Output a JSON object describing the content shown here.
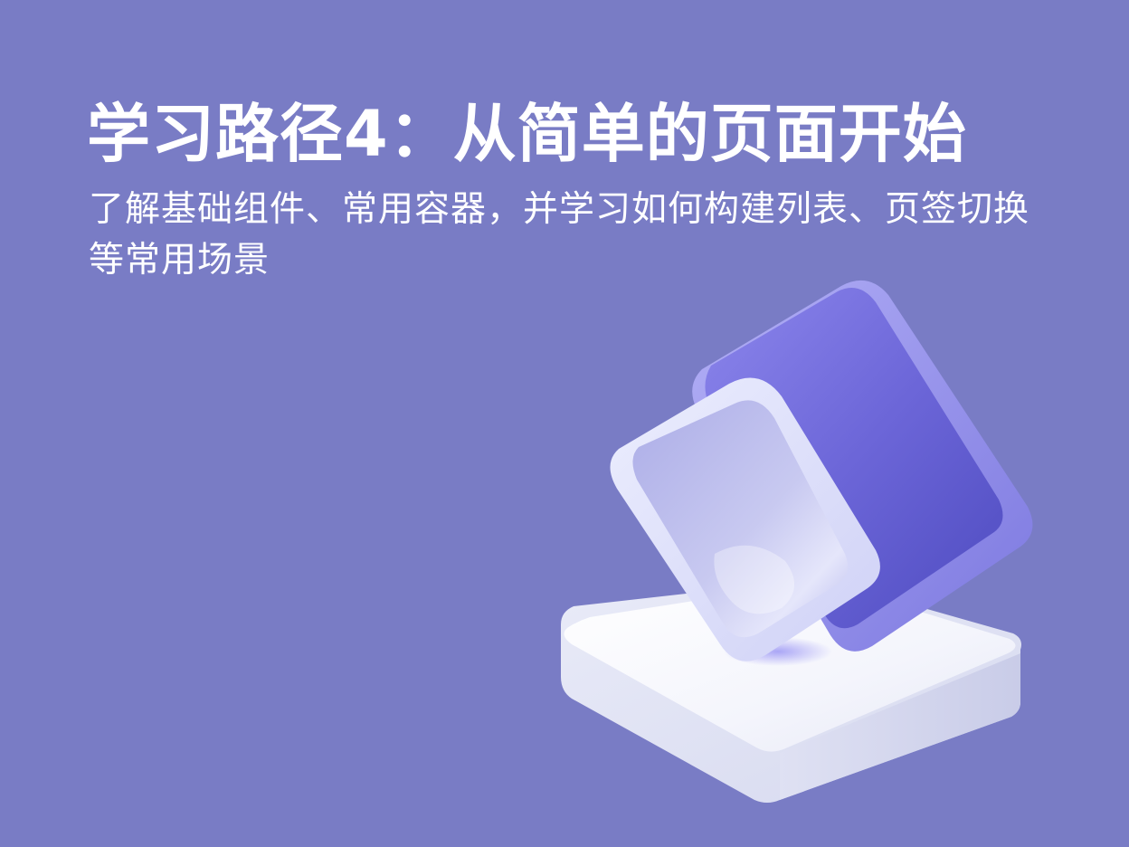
{
  "colors": {
    "background": "#797cc5",
    "text": "#ffffff",
    "back_tile": "#6a66d6",
    "front_tile": "#c8c9f2",
    "base": "#f2f4fb"
  },
  "title": "学习路径4：从简单的页面开始",
  "subtitle": "了解基础组件、常用容器，并学习如何构建列表、页签切换等常用场景",
  "illustration": {
    "icon": "glass-tiles-on-stand-icon"
  }
}
